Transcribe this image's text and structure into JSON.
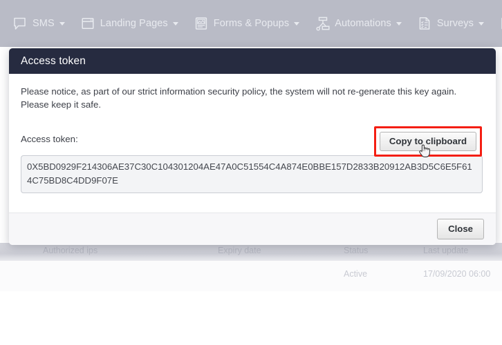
{
  "topnav": {
    "items": [
      {
        "label": "SMS",
        "icon": "chat-bubble-icon",
        "has_caret": true
      },
      {
        "label": "Landing Pages",
        "icon": "browser-window-icon",
        "has_caret": true
      },
      {
        "label": "Forms & Popups",
        "icon": "form-document-icon",
        "has_caret": true
      },
      {
        "label": "Automations",
        "icon": "workflow-nodes-icon",
        "has_caret": true
      },
      {
        "label": "Surveys",
        "icon": "checklist-document-icon",
        "has_caret": true
      },
      {
        "label": "",
        "icon": "partial-document-icon",
        "has_caret": false
      }
    ],
    "background_color": "#b9bbc6",
    "text_color": "#eceef3"
  },
  "background_table": {
    "headers": [
      "Authorized ips",
      "Expiry date",
      "Status",
      "Last update"
    ],
    "rows": [
      {
        "authorized_ips": "",
        "expiry_date": "",
        "status": "Active",
        "last_update": "17/09/2020 06:00"
      }
    ]
  },
  "modal": {
    "title": "Access token",
    "header_color": "#262b40",
    "notice": "Please notice, as part of our strict information security policy, the system will not re-generate this key again. Please keep it safe.",
    "token_label": "Access token:",
    "copy_button_label": "Copy to clipboard",
    "token_value": "0X5BD0929F214306AE37C30C104301204AE47A0C51554C4A874E0BBE157D2833B20912AB3D5C6E5F614C75BD8C4DD9F07E",
    "close_button_label": "Close",
    "highlight_color": "#f41e12"
  },
  "cursor": {
    "type": "pointer-hand-cursor"
  }
}
